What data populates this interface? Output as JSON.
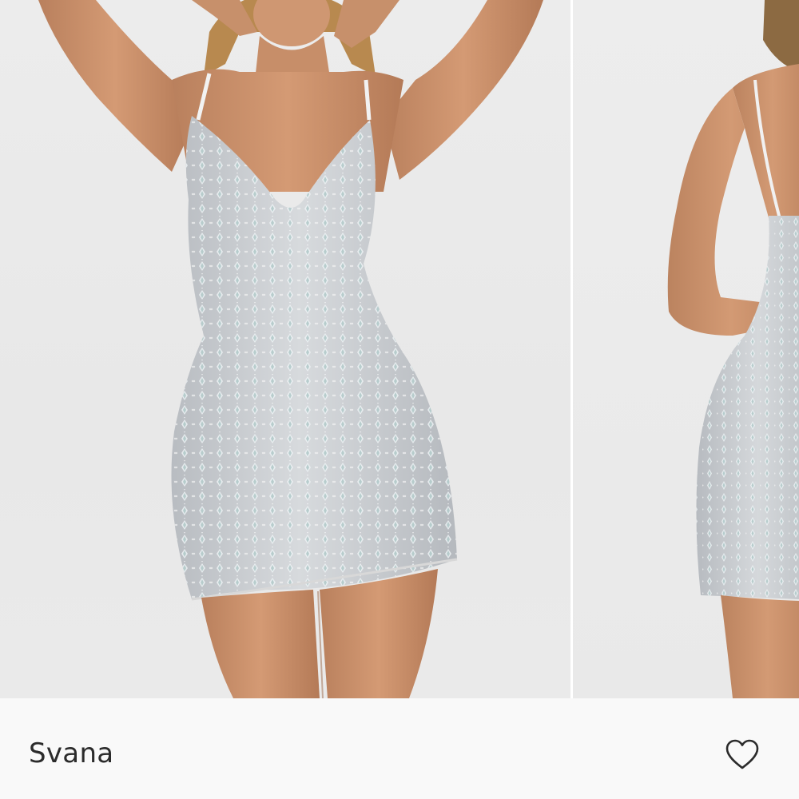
{
  "product": {
    "name": "Svana"
  },
  "gallery": {
    "images": [
      {
        "icon": "model-front-photo"
      },
      {
        "icon": "model-back-photo"
      }
    ]
  },
  "actions": {
    "wishlist_icon": "heart-outline-icon"
  },
  "colors": {
    "background": "#e9e9e9",
    "info_bar": "#f9f9f9",
    "text": "#2b2b2b",
    "dress": "#c9ccd0",
    "skin": "#c98f6a"
  }
}
